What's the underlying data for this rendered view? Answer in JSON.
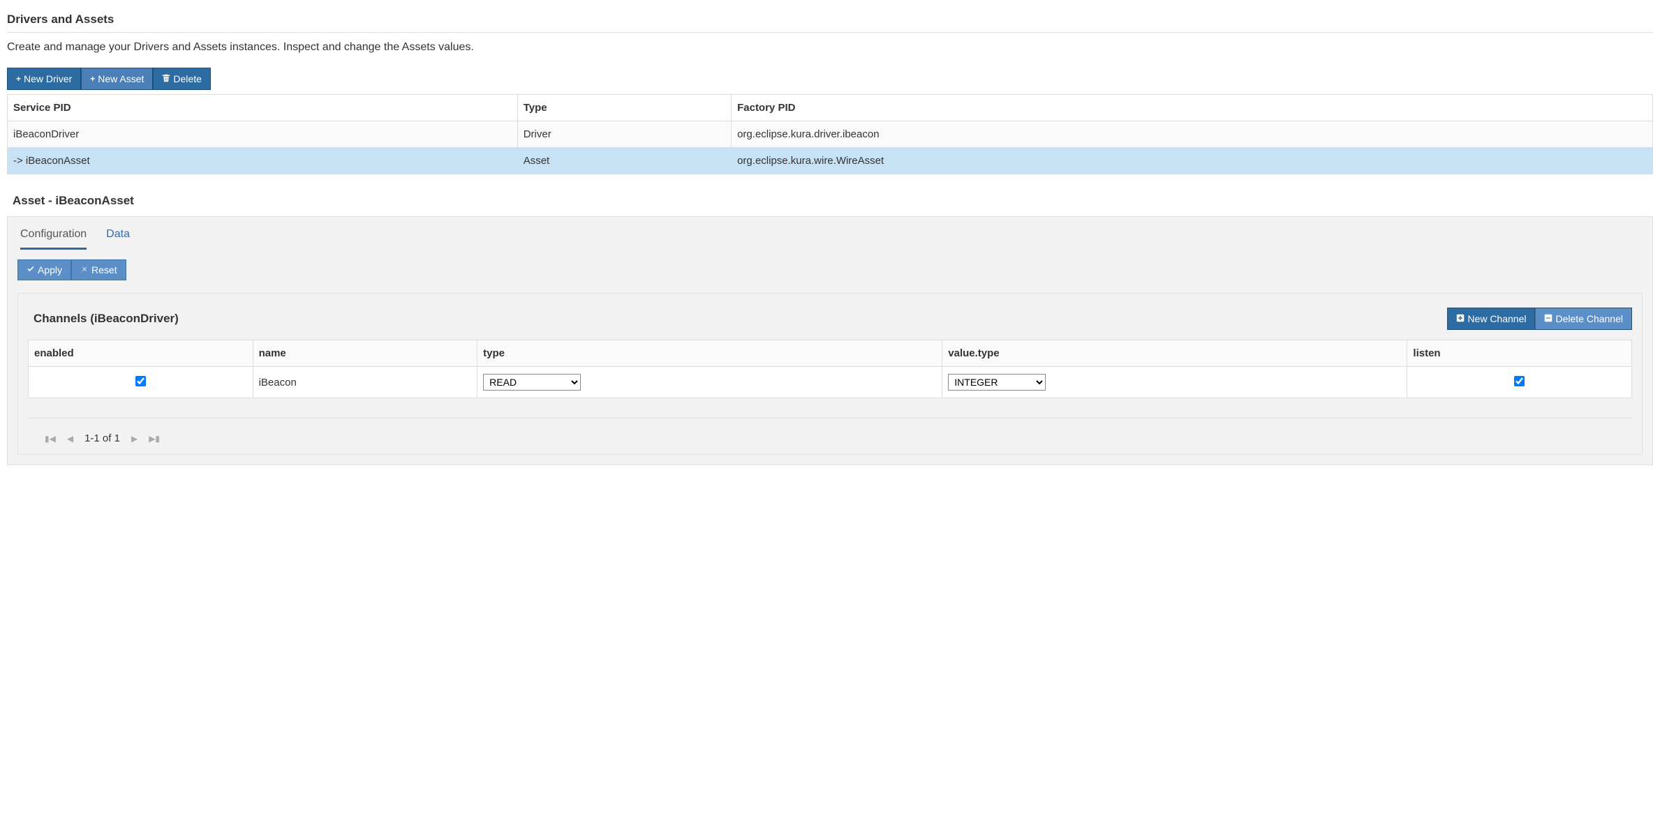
{
  "header": {
    "title": "Drivers and Assets",
    "description": "Create and manage your Drivers and Assets instances. Inspect and change the Assets values."
  },
  "toolbar": {
    "new_driver": "New Driver",
    "new_asset": "New Asset",
    "delete": "Delete"
  },
  "instances_table": {
    "columns": {
      "service_pid": "Service PID",
      "type": "Type",
      "factory_pid": "Factory PID"
    },
    "rows": [
      {
        "service_pid": "iBeaconDriver",
        "type": "Driver",
        "factory_pid": "org.eclipse.kura.driver.ibeacon",
        "selected": false
      },
      {
        "service_pid": "-> iBeaconAsset",
        "type": "Asset",
        "factory_pid": "org.eclipse.kura.wire.WireAsset",
        "selected": true
      }
    ]
  },
  "asset": {
    "title": "Asset - iBeaconAsset",
    "tabs": {
      "configuration": "Configuration",
      "data": "Data"
    },
    "apply": "Apply",
    "reset": "Reset",
    "channels": {
      "title": "Channels (iBeaconDriver)",
      "new_channel": "New Channel",
      "delete_channel": "Delete Channel",
      "columns": {
        "enabled": "enabled",
        "name": "name",
        "type": "type",
        "value_type": "value.type",
        "listen": "listen"
      },
      "rows": [
        {
          "enabled": true,
          "name": "iBeacon",
          "type": "READ",
          "value_type": "INTEGER",
          "listen": true
        }
      ],
      "pager": "1-1 of 1"
    }
  }
}
